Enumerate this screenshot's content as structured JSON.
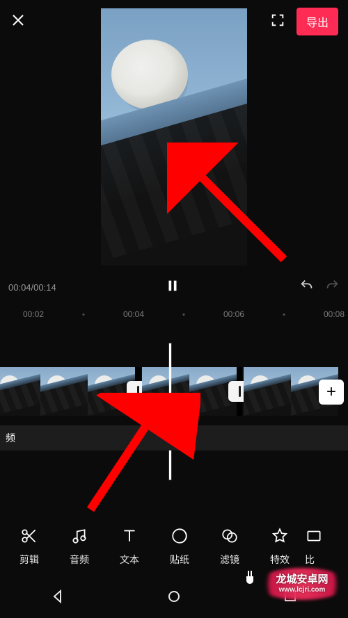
{
  "header": {
    "export_label": "导出"
  },
  "playback": {
    "timecode": "00:04/00:14"
  },
  "ruler": {
    "ticks": [
      "00:02",
      "00:04",
      "00:06",
      "00:08"
    ]
  },
  "audio_track": {
    "label": "频"
  },
  "toolbar": {
    "items": [
      {
        "icon": "scissors-icon",
        "label": "剪辑"
      },
      {
        "icon": "music-note-icon",
        "label": "音频"
      },
      {
        "icon": "text-icon",
        "label": "文本"
      },
      {
        "icon": "sticker-icon",
        "label": "贴纸"
      },
      {
        "icon": "filter-icon",
        "label": "滤镜"
      },
      {
        "icon": "star-icon",
        "label": "特效"
      },
      {
        "icon": "ratio-icon",
        "label": "比"
      }
    ]
  },
  "watermark": {
    "line1": "龙城安卓网",
    "line2": "www.lcjri.com"
  }
}
